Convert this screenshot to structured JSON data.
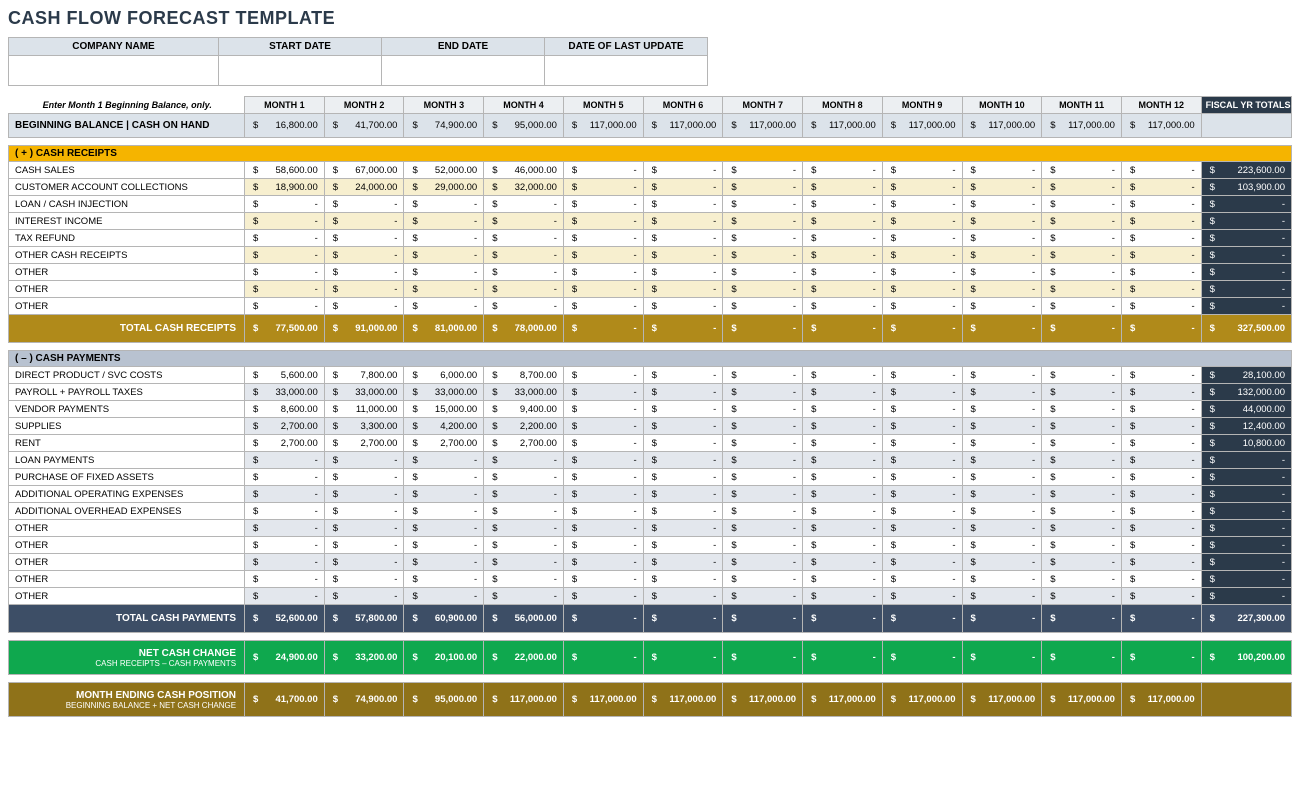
{
  "title": "CASH FLOW FORECAST TEMPLATE",
  "info_headers": [
    "COMPANY NAME",
    "START DATE",
    "END DATE",
    "DATE OF LAST UPDATE"
  ],
  "header_note": "Enter Month 1 Beginning Balance, only.",
  "month_headers": [
    "MONTH 1",
    "MONTH 2",
    "MONTH 3",
    "MONTH 4",
    "MONTH 5",
    "MONTH 6",
    "MONTH 7",
    "MONTH 8",
    "MONTH 9",
    "MONTH 10",
    "MONTH 11",
    "MONTH 12"
  ],
  "fiscal_header": "FISCAL YR TOTALS",
  "beginning_label": "BEGINNING BALANCE  |  CASH ON HAND",
  "beginning_values": [
    "16,800.00",
    "41,700.00",
    "74,900.00",
    "95,000.00",
    "117,000.00",
    "117,000.00",
    "117,000.00",
    "117,000.00",
    "117,000.00",
    "117,000.00",
    "117,000.00",
    "117,000.00"
  ],
  "receipts_section": "( + )   CASH RECEIPTS",
  "receipts_rows": [
    {
      "label": "CASH SALES",
      "values": [
        "58,600.00",
        "67,000.00",
        "52,000.00",
        "46,000.00",
        "-",
        "-",
        "-",
        "-",
        "-",
        "-",
        "-",
        "-"
      ],
      "total": "223,600.00"
    },
    {
      "label": "CUSTOMER ACCOUNT COLLECTIONS",
      "values": [
        "18,900.00",
        "24,000.00",
        "29,000.00",
        "32,000.00",
        "-",
        "-",
        "-",
        "-",
        "-",
        "-",
        "-",
        "-"
      ],
      "total": "103,900.00"
    },
    {
      "label": "LOAN / CASH INJECTION",
      "values": [
        "-",
        "-",
        "-",
        "-",
        "-",
        "-",
        "-",
        "-",
        "-",
        "-",
        "-",
        "-"
      ],
      "total": "-"
    },
    {
      "label": "INTEREST INCOME",
      "values": [
        "-",
        "-",
        "-",
        "-",
        "-",
        "-",
        "-",
        "-",
        "-",
        "-",
        "-",
        "-"
      ],
      "total": "-"
    },
    {
      "label": "TAX REFUND",
      "values": [
        "-",
        "-",
        "-",
        "-",
        "-",
        "-",
        "-",
        "-",
        "-",
        "-",
        "-",
        "-"
      ],
      "total": "-"
    },
    {
      "label": "OTHER CASH RECEIPTS",
      "values": [
        "-",
        "-",
        "-",
        "-",
        "-",
        "-",
        "-",
        "-",
        "-",
        "-",
        "-",
        "-"
      ],
      "total": "-"
    },
    {
      "label": "OTHER",
      "values": [
        "-",
        "-",
        "-",
        "-",
        "-",
        "-",
        "-",
        "-",
        "-",
        "-",
        "-",
        "-"
      ],
      "total": "-"
    },
    {
      "label": "OTHER",
      "values": [
        "-",
        "-",
        "-",
        "-",
        "-",
        "-",
        "-",
        "-",
        "-",
        "-",
        "-",
        "-"
      ],
      "total": "-"
    },
    {
      "label": "OTHER",
      "values": [
        "-",
        "-",
        "-",
        "-",
        "-",
        "-",
        "-",
        "-",
        "-",
        "-",
        "-",
        "-"
      ],
      "total": "-"
    }
  ],
  "total_receipts_label": "TOTAL CASH RECEIPTS",
  "total_receipts_values": [
    "77,500.00",
    "91,000.00",
    "81,000.00",
    "78,000.00",
    "-",
    "-",
    "-",
    "-",
    "-",
    "-",
    "-",
    "-"
  ],
  "total_receipts_total": "327,500.00",
  "payments_section": "( – )   CASH PAYMENTS",
  "payments_rows": [
    {
      "label": "DIRECT PRODUCT / SVC COSTS",
      "values": [
        "5,600.00",
        "7,800.00",
        "6,000.00",
        "8,700.00",
        "-",
        "-",
        "-",
        "-",
        "-",
        "-",
        "-",
        "-"
      ],
      "total": "28,100.00"
    },
    {
      "label": "PAYROLL + PAYROLL TAXES",
      "values": [
        "33,000.00",
        "33,000.00",
        "33,000.00",
        "33,000.00",
        "-",
        "-",
        "-",
        "-",
        "-",
        "-",
        "-",
        "-"
      ],
      "total": "132,000.00"
    },
    {
      "label": "VENDOR PAYMENTS",
      "values": [
        "8,600.00",
        "11,000.00",
        "15,000.00",
        "9,400.00",
        "-",
        "-",
        "-",
        "-",
        "-",
        "-",
        "-",
        "-"
      ],
      "total": "44,000.00"
    },
    {
      "label": "SUPPLIES",
      "values": [
        "2,700.00",
        "3,300.00",
        "4,200.00",
        "2,200.00",
        "-",
        "-",
        "-",
        "-",
        "-",
        "-",
        "-",
        "-"
      ],
      "total": "12,400.00"
    },
    {
      "label": "RENT",
      "values": [
        "2,700.00",
        "2,700.00",
        "2,700.00",
        "2,700.00",
        "-",
        "-",
        "-",
        "-",
        "-",
        "-",
        "-",
        "-"
      ],
      "total": "10,800.00"
    },
    {
      "label": "LOAN PAYMENTS",
      "values": [
        "-",
        "-",
        "-",
        "-",
        "-",
        "-",
        "-",
        "-",
        "-",
        "-",
        "-",
        "-"
      ],
      "total": "-"
    },
    {
      "label": "PURCHASE OF FIXED ASSETS",
      "values": [
        "-",
        "-",
        "-",
        "-",
        "-",
        "-",
        "-",
        "-",
        "-",
        "-",
        "-",
        "-"
      ],
      "total": "-"
    },
    {
      "label": "ADDITIONAL OPERATING EXPENSES",
      "values": [
        "-",
        "-",
        "-",
        "-",
        "-",
        "-",
        "-",
        "-",
        "-",
        "-",
        "-",
        "-"
      ],
      "total": "-"
    },
    {
      "label": "ADDITIONAL OVERHEAD EXPENSES",
      "values": [
        "-",
        "-",
        "-",
        "-",
        "-",
        "-",
        "-",
        "-",
        "-",
        "-",
        "-",
        "-"
      ],
      "total": "-"
    },
    {
      "label": "OTHER",
      "values": [
        "-",
        "-",
        "-",
        "-",
        "-",
        "-",
        "-",
        "-",
        "-",
        "-",
        "-",
        "-"
      ],
      "total": "-"
    },
    {
      "label": "OTHER",
      "values": [
        "-",
        "-",
        "-",
        "-",
        "-",
        "-",
        "-",
        "-",
        "-",
        "-",
        "-",
        "-"
      ],
      "total": "-"
    },
    {
      "label": "OTHER",
      "values": [
        "-",
        "-",
        "-",
        "-",
        "-",
        "-",
        "-",
        "-",
        "-",
        "-",
        "-",
        "-"
      ],
      "total": "-"
    },
    {
      "label": "OTHER",
      "values": [
        "-",
        "-",
        "-",
        "-",
        "-",
        "-",
        "-",
        "-",
        "-",
        "-",
        "-",
        "-"
      ],
      "total": "-"
    },
    {
      "label": "OTHER",
      "values": [
        "-",
        "-",
        "-",
        "-",
        "-",
        "-",
        "-",
        "-",
        "-",
        "-",
        "-",
        "-"
      ],
      "total": "-"
    }
  ],
  "total_payments_label": "TOTAL CASH PAYMENTS",
  "total_payments_values": [
    "52,600.00",
    "57,800.00",
    "60,900.00",
    "56,000.00",
    "-",
    "-",
    "-",
    "-",
    "-",
    "-",
    "-",
    "-"
  ],
  "total_payments_total": "227,300.00",
  "net_change_label": "NET CASH CHANGE",
  "net_change_sub": "CASH RECEIPTS – CASH PAYMENTS",
  "net_change_values": [
    "24,900.00",
    "33,200.00",
    "20,100.00",
    "22,000.00",
    "-",
    "-",
    "-",
    "-",
    "-",
    "-",
    "-",
    "-"
  ],
  "net_change_total": "100,200.00",
  "ending_label": "MONTH ENDING CASH POSITION",
  "ending_sub": "BEGINNING BALANCE + NET CASH CHANGE",
  "ending_values": [
    "41,700.00",
    "74,900.00",
    "95,000.00",
    "117,000.00",
    "117,000.00",
    "117,000.00",
    "117,000.00",
    "117,000.00",
    "117,000.00",
    "117,000.00",
    "117,000.00",
    "117,000.00"
  ]
}
